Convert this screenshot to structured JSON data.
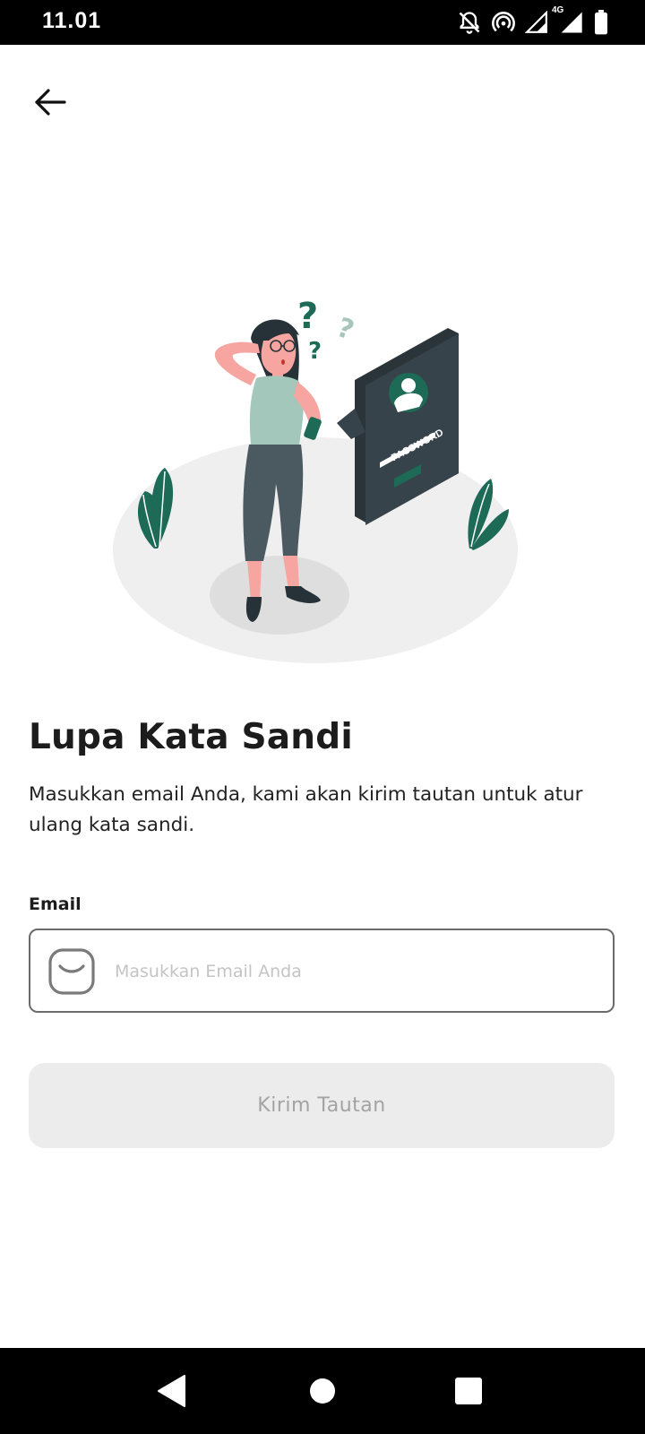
{
  "status_bar": {
    "time": "11.01",
    "network_label": "4G",
    "icons": [
      "bell-off-icon",
      "hotspot-icon",
      "signal-icon",
      "signal-4g-icon",
      "battery-icon"
    ]
  },
  "header": {
    "back_icon": "arrow-left-icon"
  },
  "illustration": {
    "card_label": "PASSWORD",
    "question_marks": [
      "?",
      "?",
      "?"
    ]
  },
  "main": {
    "title": "Lupa Kata Sandi",
    "description": "Masukkan email Anda, kami akan kirim tautan untuk atur ulang kata sandi.",
    "email_label": "Email",
    "email_value": "",
    "email_placeholder": "Masukkan Email Anda",
    "email_icon": "mail-icon",
    "submit_label": "Kirim Tautan"
  },
  "nav_bar": {
    "icons": [
      "nav-back-icon",
      "nav-home-icon",
      "nav-recents-icon"
    ]
  },
  "colors": {
    "accent": "#1d6b57",
    "title": "#1c1c1c",
    "button_bg": "#ececec",
    "button_text": "#a3a3a3",
    "field_border": "#6b6b6b",
    "placeholder": "#c4c4c4"
  }
}
